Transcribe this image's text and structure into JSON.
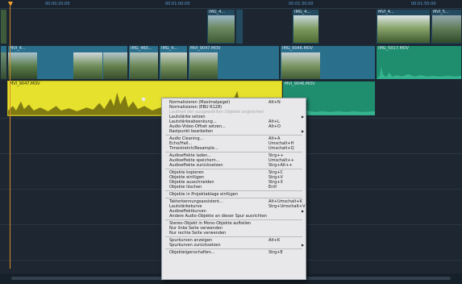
{
  "ruler": {
    "ticks": [
      "00:00:20:00",
      "00:01:00:00",
      "00:01:30:00",
      "00:01:50:00"
    ]
  },
  "tracks": {
    "top_clips": [
      "IMG_4...",
      "IMG_4...",
      "MVI_4...",
      "MVI_5..."
    ],
    "video_clips": [
      "MVI_4...",
      "IMG_460...",
      "IMG_4...",
      "MVI_9047.MOV",
      "IMG_9046.MOV",
      "IMG_5017.MOV"
    ],
    "audio_clips": [
      "MVI_9047.MOV",
      "MVI_9046.MOV"
    ]
  },
  "context_menu": {
    "items": [
      {
        "label": "Normalisieren (Maximalpegel)",
        "shortcut": "Alt+N"
      },
      {
        "label": "Normalisieren (EBU R128)",
        "shortcut": ""
      },
      {
        "label": "Lautheit der ausgewählten Objekte angleichen",
        "shortcut": "",
        "disabled": true
      },
      {
        "label": "Lautstärke setzen",
        "shortcut": "",
        "submenu": true
      },
      {
        "label": "Lautstärkeabsenkung...",
        "shortcut": "Alt+L"
      },
      {
        "label": "Audio-Video-Offset setzen...",
        "shortcut": "Alt+O"
      },
      {
        "label": "Rastpunkt bearbeiten",
        "shortcut": "",
        "submenu": true
      },
      {
        "sep": true
      },
      {
        "label": "Audio Cleaning...",
        "shortcut": "Alt+A"
      },
      {
        "label": "Echo/Hall...",
        "shortcut": "Umschalt+H"
      },
      {
        "label": "Timestretch/Resample...",
        "shortcut": "Umschalt+Q"
      },
      {
        "sep": true
      },
      {
        "label": "Audioeffekte laden...",
        "shortcut": "Strg++"
      },
      {
        "label": "Audioeffekte speichern...",
        "shortcut": "Umschalt++"
      },
      {
        "label": "Audioeffekte zurücksetzen",
        "shortcut": "Strg+Alt++"
      },
      {
        "sep": true
      },
      {
        "label": "Objekte kopieren",
        "shortcut": "Strg+C"
      },
      {
        "label": "Objekte einfügen",
        "shortcut": "Strg+V"
      },
      {
        "label": "Objekte ausschneiden",
        "shortcut": "Strg+X"
      },
      {
        "label": "Objekte löschen",
        "shortcut": "Entf"
      },
      {
        "sep": true
      },
      {
        "label": "Objekte in Projektablage einfügen",
        "shortcut": ""
      },
      {
        "sep": true
      },
      {
        "label": "Takterkennungsassistent...",
        "shortcut": "Alt+Umschalt+K"
      },
      {
        "label": "Lautstärkekurve",
        "shortcut": "Strg+Umschalt+V"
      },
      {
        "label": "Audioeffektkurven",
        "shortcut": "",
        "submenu": true
      },
      {
        "label": "Andere Audio-Objekte an dieser Spur ausrichten",
        "shortcut": ""
      },
      {
        "sep": true
      },
      {
        "label": "Stereo-Objekt in Mono-Objekte aufteilen",
        "shortcut": ""
      },
      {
        "label": "Nur linke Seite verwenden",
        "shortcut": ""
      },
      {
        "label": "Nur rechte Seite verwenden",
        "shortcut": ""
      },
      {
        "sep": true
      },
      {
        "label": "Spurkurven anzeigen",
        "shortcut": "Alt+K"
      },
      {
        "label": "Spurkurven zurücksetzen",
        "shortcut": "",
        "submenu": true
      },
      {
        "sep": true
      },
      {
        "label": "Objekteigenschaften...",
        "shortcut": "Strg+E"
      }
    ]
  },
  "colors": {
    "audio_selected": "#e6e12c",
    "audio_clip": "#1f8e6e",
    "video_clip": "#2a6f8c",
    "menu_bg": "#e8e8ea"
  }
}
